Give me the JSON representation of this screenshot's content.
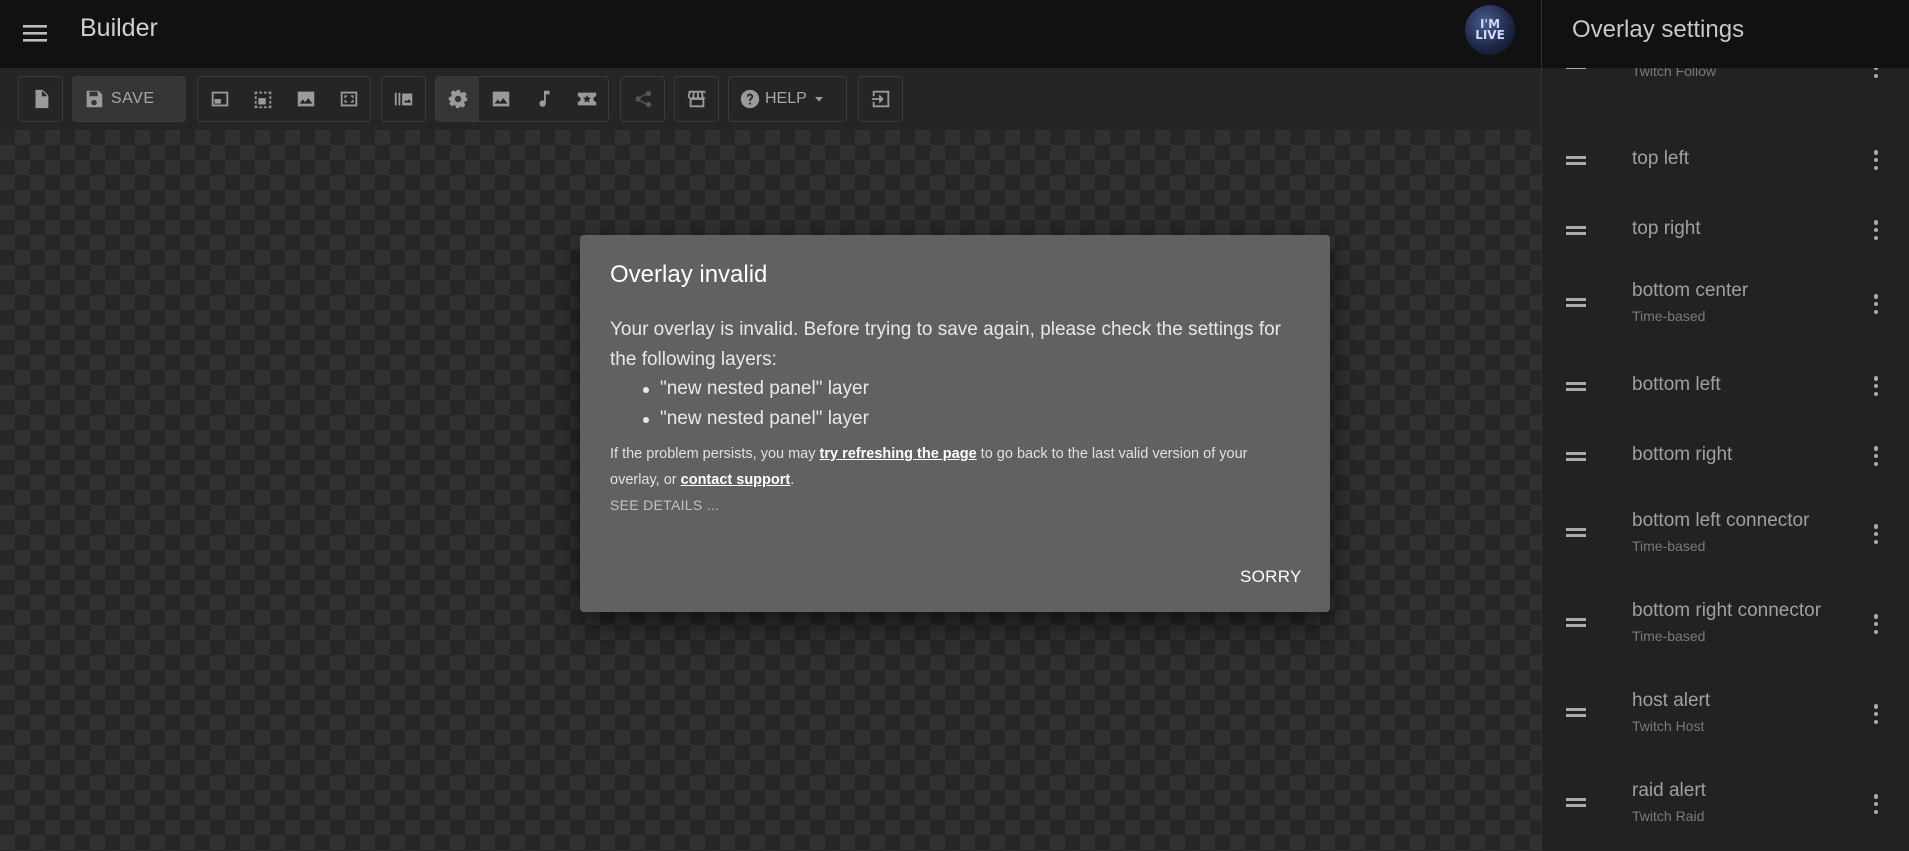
{
  "header": {
    "title": "Builder",
    "avatar_text": "I'M LIVE"
  },
  "toolbar": {
    "save_label": "SAVE",
    "help_label": "HELP"
  },
  "panel": {
    "title": "Overlay settings",
    "layers": [
      {
        "name": "",
        "sub": "Twitch Follow"
      },
      {
        "name": "top left",
        "sub": ""
      },
      {
        "name": "top right",
        "sub": ""
      },
      {
        "name": "bottom center",
        "sub": "Time-based"
      },
      {
        "name": "bottom left",
        "sub": ""
      },
      {
        "name": "bottom right",
        "sub": ""
      },
      {
        "name": "bottom left connector",
        "sub": "Time-based"
      },
      {
        "name": "bottom right connector",
        "sub": "Time-based"
      },
      {
        "name": "host alert",
        "sub": "Twitch Host"
      },
      {
        "name": "raid alert",
        "sub": "Twitch Raid"
      }
    ]
  },
  "dialog": {
    "title": "Overlay invalid",
    "body": "Your overlay is invalid. Before trying to save again, please check the settings for the following layers:",
    "layers": [
      "\"new nested panel\" layer",
      "\"new nested panel\" layer"
    ],
    "note_prefix": "If the problem persists, you may ",
    "note_link1": "try refreshing the page",
    "note_middle": " to go back to the last valid version of your overlay, or ",
    "note_link2": "contact support",
    "note_suffix": ".",
    "details_label": "SEE DETAILS ...",
    "sorry_label": "SORRY"
  }
}
